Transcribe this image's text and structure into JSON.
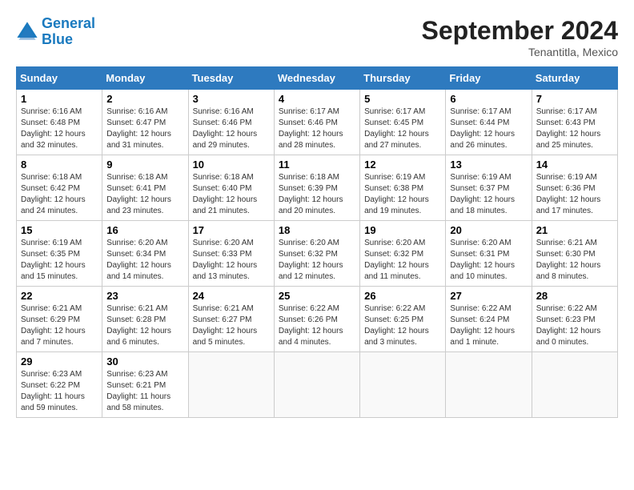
{
  "logo": {
    "line1": "General",
    "line2": "Blue"
  },
  "title": "September 2024",
  "subtitle": "Tenantitla, Mexico",
  "headers": [
    "Sunday",
    "Monday",
    "Tuesday",
    "Wednesday",
    "Thursday",
    "Friday",
    "Saturday"
  ],
  "weeks": [
    [
      {
        "day": "1",
        "sunrise": "6:16 AM",
        "sunset": "6:48 PM",
        "daylight": "12 hours and 32 minutes."
      },
      {
        "day": "2",
        "sunrise": "6:16 AM",
        "sunset": "6:47 PM",
        "daylight": "12 hours and 31 minutes."
      },
      {
        "day": "3",
        "sunrise": "6:16 AM",
        "sunset": "6:46 PM",
        "daylight": "12 hours and 29 minutes."
      },
      {
        "day": "4",
        "sunrise": "6:17 AM",
        "sunset": "6:46 PM",
        "daylight": "12 hours and 28 minutes."
      },
      {
        "day": "5",
        "sunrise": "6:17 AM",
        "sunset": "6:45 PM",
        "daylight": "12 hours and 27 minutes."
      },
      {
        "day": "6",
        "sunrise": "6:17 AM",
        "sunset": "6:44 PM",
        "daylight": "12 hours and 26 minutes."
      },
      {
        "day": "7",
        "sunrise": "6:17 AM",
        "sunset": "6:43 PM",
        "daylight": "12 hours and 25 minutes."
      }
    ],
    [
      {
        "day": "8",
        "sunrise": "6:18 AM",
        "sunset": "6:42 PM",
        "daylight": "12 hours and 24 minutes."
      },
      {
        "day": "9",
        "sunrise": "6:18 AM",
        "sunset": "6:41 PM",
        "daylight": "12 hours and 23 minutes."
      },
      {
        "day": "10",
        "sunrise": "6:18 AM",
        "sunset": "6:40 PM",
        "daylight": "12 hours and 21 minutes."
      },
      {
        "day": "11",
        "sunrise": "6:18 AM",
        "sunset": "6:39 PM",
        "daylight": "12 hours and 20 minutes."
      },
      {
        "day": "12",
        "sunrise": "6:19 AM",
        "sunset": "6:38 PM",
        "daylight": "12 hours and 19 minutes."
      },
      {
        "day": "13",
        "sunrise": "6:19 AM",
        "sunset": "6:37 PM",
        "daylight": "12 hours and 18 minutes."
      },
      {
        "day": "14",
        "sunrise": "6:19 AM",
        "sunset": "6:36 PM",
        "daylight": "12 hours and 17 minutes."
      }
    ],
    [
      {
        "day": "15",
        "sunrise": "6:19 AM",
        "sunset": "6:35 PM",
        "daylight": "12 hours and 15 minutes."
      },
      {
        "day": "16",
        "sunrise": "6:20 AM",
        "sunset": "6:34 PM",
        "daylight": "12 hours and 14 minutes."
      },
      {
        "day": "17",
        "sunrise": "6:20 AM",
        "sunset": "6:33 PM",
        "daylight": "12 hours and 13 minutes."
      },
      {
        "day": "18",
        "sunrise": "6:20 AM",
        "sunset": "6:32 PM",
        "daylight": "12 hours and 12 minutes."
      },
      {
        "day": "19",
        "sunrise": "6:20 AM",
        "sunset": "6:32 PM",
        "daylight": "12 hours and 11 minutes."
      },
      {
        "day": "20",
        "sunrise": "6:20 AM",
        "sunset": "6:31 PM",
        "daylight": "12 hours and 10 minutes."
      },
      {
        "day": "21",
        "sunrise": "6:21 AM",
        "sunset": "6:30 PM",
        "daylight": "12 hours and 8 minutes."
      }
    ],
    [
      {
        "day": "22",
        "sunrise": "6:21 AM",
        "sunset": "6:29 PM",
        "daylight": "12 hours and 7 minutes."
      },
      {
        "day": "23",
        "sunrise": "6:21 AM",
        "sunset": "6:28 PM",
        "daylight": "12 hours and 6 minutes."
      },
      {
        "day": "24",
        "sunrise": "6:21 AM",
        "sunset": "6:27 PM",
        "daylight": "12 hours and 5 minutes."
      },
      {
        "day": "25",
        "sunrise": "6:22 AM",
        "sunset": "6:26 PM",
        "daylight": "12 hours and 4 minutes."
      },
      {
        "day": "26",
        "sunrise": "6:22 AM",
        "sunset": "6:25 PM",
        "daylight": "12 hours and 3 minutes."
      },
      {
        "day": "27",
        "sunrise": "6:22 AM",
        "sunset": "6:24 PM",
        "daylight": "12 hours and 1 minute."
      },
      {
        "day": "28",
        "sunrise": "6:22 AM",
        "sunset": "6:23 PM",
        "daylight": "12 hours and 0 minutes."
      }
    ],
    [
      {
        "day": "29",
        "sunrise": "6:23 AM",
        "sunset": "6:22 PM",
        "daylight": "11 hours and 59 minutes."
      },
      {
        "day": "30",
        "sunrise": "6:23 AM",
        "sunset": "6:21 PM",
        "daylight": "11 hours and 58 minutes."
      },
      null,
      null,
      null,
      null,
      null
    ]
  ]
}
